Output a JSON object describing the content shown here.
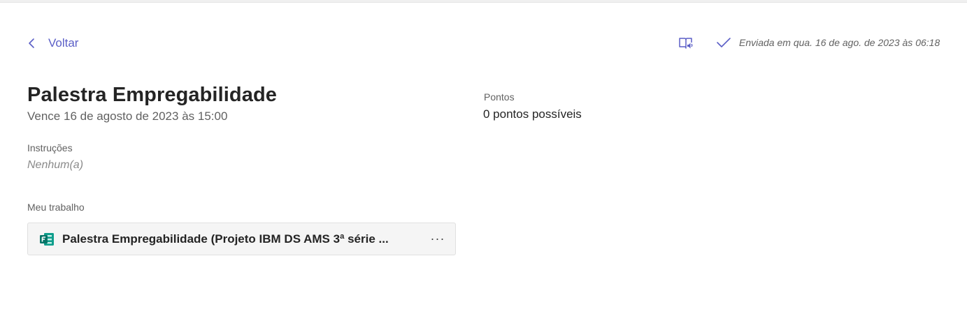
{
  "nav": {
    "back_label": "Voltar"
  },
  "header": {
    "status_text": "Enviada em qua. 16 de ago. de 2023 às 06:18",
    "reader_icon": "immersive-reader-icon",
    "check_icon": "checkmark-icon"
  },
  "assignment": {
    "title": "Palestra Empregabilidade",
    "due": "Vence 16 de agosto de 2023 às 15:00",
    "instructions_label": "Instruções",
    "instructions_value": "Nenhum(a)",
    "my_work_label": "Meu trabalho",
    "attachment": {
      "name": "Palestra Empregabilidade (Projeto IBM DS AMS 3ª série ...",
      "icon": "microsoft-forms-icon",
      "more_label": "···"
    }
  },
  "points": {
    "label": "Pontos",
    "value": "0 pontos possíveis"
  },
  "colors": {
    "accent": "#5b5fc7",
    "forms_green": "#077568"
  }
}
